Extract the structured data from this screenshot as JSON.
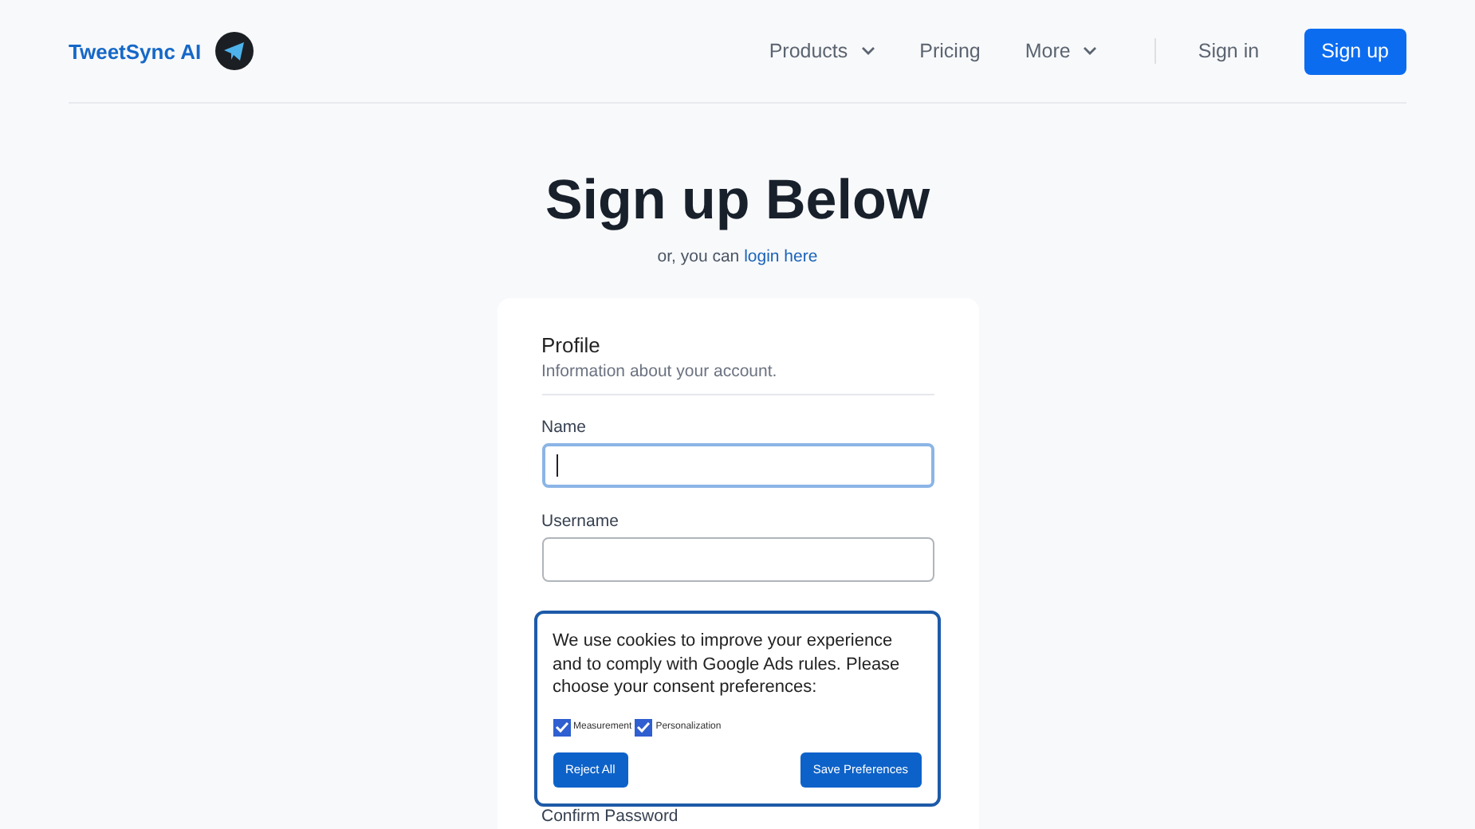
{
  "header": {
    "brand": "TweetSync AI",
    "nav": [
      {
        "label": "Products",
        "has_menu": true
      },
      {
        "label": "Pricing",
        "has_menu": false
      },
      {
        "label": "More",
        "has_menu": true
      }
    ],
    "sign_in": "Sign in",
    "sign_up": "Sign up"
  },
  "title": "Sign up Below",
  "subtitle": "or, you can",
  "subtitle_link": "login here",
  "form": {
    "section_title": "Profile",
    "section_hint": "Information about your account.",
    "fields": [
      {
        "label": "Name",
        "focused": true
      },
      {
        "label": "Username",
        "focused": false
      }
    ],
    "cut_label": "Confirm Password"
  },
  "cookie_banner": {
    "text": "We use cookies to improve your experience and to comply with Google Ads rules. Please choose your consent preferences:",
    "options": [
      {
        "label": "Measurement",
        "checked": true
      },
      {
        "label": "Personalization",
        "checked": true
      }
    ],
    "reject": "Reject All",
    "save": "Save Preferences"
  }
}
